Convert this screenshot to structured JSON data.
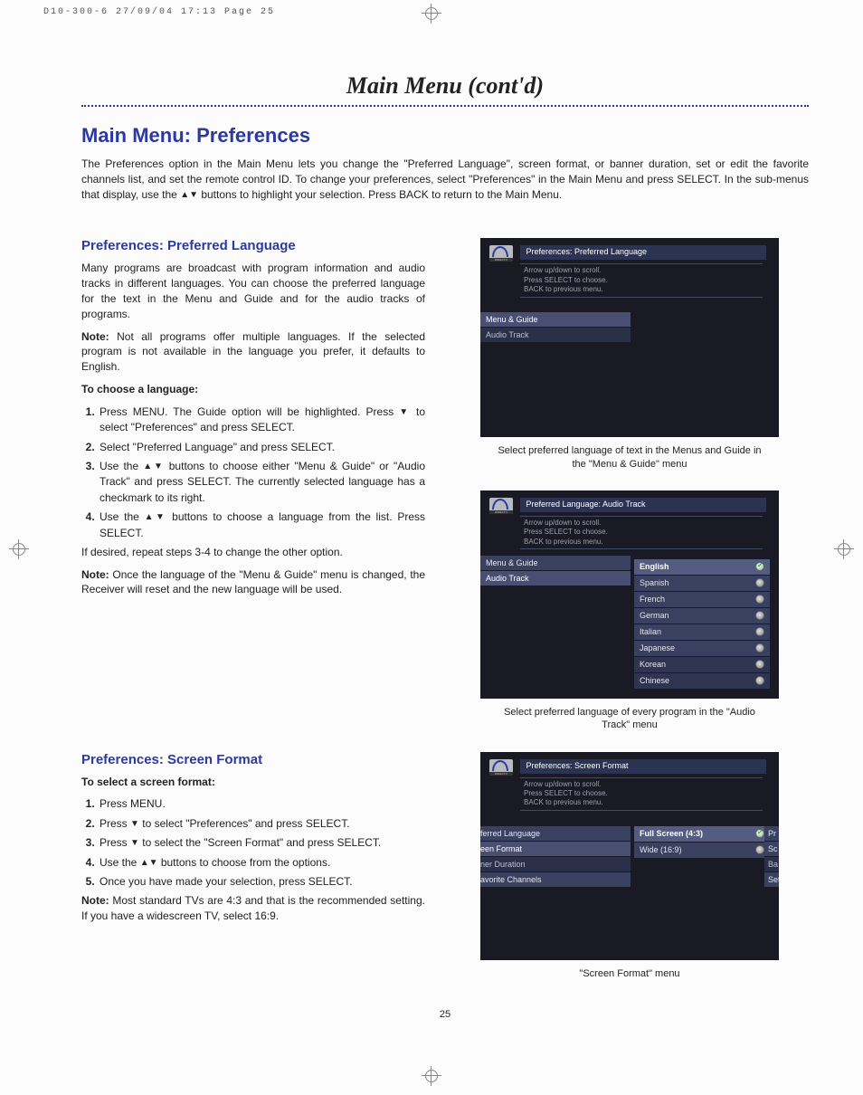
{
  "header_strip": "D10-300-6  27/09/04  17:13  Page 25",
  "chapter_title": "Main Menu (cont'd)",
  "h1": "Main Menu: Preferences",
  "intro_a": "The Preferences option in the Main Menu lets you change the \"Preferred Language\", screen format, or banner duration, set or edit the favorite channels list, and set the remote control ID. To change your preferences, select \"Preferences\" in the Main Menu and press SELECT. In the sub-menus that display, use the ",
  "intro_b": " buttons to highlight your selection. Press BACK to return to the Main Menu.",
  "pl": {
    "h2": "Preferences: Preferred Language",
    "p1": "Many programs are broadcast with program information and audio tracks in different languages. You can choose the preferred language for the text in the Menu and Guide and for the audio tracks of programs.",
    "note_b": "Note:",
    "note_t": " Not all programs offer multiple languages. If the selected program is not available in the language you prefer, it defaults to English.",
    "choose_h": "To choose a language:",
    "s1a": "Press MENU. The Guide option will be highlighted. Press ",
    "s1b": " to select \"Preferences\" and press SELECT.",
    "s2": "Select \"Preferred Language\" and press SELECT.",
    "s3a": "Use the ",
    "s3b": " buttons to choose either \"Menu & Guide\" or \"Audio Track\" and press SELECT. The currently selected language has a checkmark to its right.",
    "s4a": "Use the ",
    "s4b": " buttons to choose a language from the list. Press SELECT.",
    "after": "If desired, repeat steps 3-4 to change the other option.",
    "note2b": "Note:",
    "note2t": " Once the language of the \"Menu & Guide\" menu is changed, the Receiver will reset and the new language will be used."
  },
  "fig1": {
    "title": "Preferences: Preferred Language",
    "hint1": "Arrow up/down to scroll.",
    "hint2": "Press SELECT to choose.",
    "hint3": "BACK to previous menu.",
    "sb1": "Menu & Guide",
    "sb2": "Audio Track",
    "caption": "Select preferred language of text in the Menus and Guide in the \"Menu & Guide\" menu"
  },
  "fig2": {
    "title": "Preferred Language: Audio Track",
    "hint1": "Arrow up/down to scroll.",
    "hint2": "Press SELECT to choose.",
    "hint3": "BACK to previous menu.",
    "sb1": "Menu & Guide",
    "sb2": "Audio Track",
    "langs": [
      "English",
      "Spanish",
      "French",
      "German",
      "Italian",
      "Japanese",
      "Korean",
      "Chinese"
    ],
    "caption": "Select preferred language of every program in the \"Audio Track\" menu"
  },
  "sf": {
    "h2": "Preferences: Screen Format",
    "choose_h": "To select a screen format:",
    "s1": "Press MENU.",
    "s2a": "Press ",
    "s2b": " to select \"Preferences\" and press SELECT.",
    "s3a": "Press ",
    "s3b": " to select the \"Screen Format\" and press SELECT.",
    "s4a": "Use the ",
    "s4b": " buttons to choose from the options.",
    "s5": "Once you have made your selection, press SELECT.",
    "note_b": "Note:",
    "note_t": " Most standard TVs are 4:3 and that is the recommended setting. If you have a widescreen TV, select 16:9."
  },
  "fig3": {
    "title": "Preferences: Screen Format",
    "hint1": "Arrow up/down to scroll.",
    "hint2": "Press SELECT to choose.",
    "hint3": "BACK to previous menu.",
    "sb1": "ferred Language",
    "sb2": "een Format",
    "sb3": "ner Duration",
    "sb4": "avorite Channels",
    "r1": "Pr",
    "r2": "Sc",
    "r3": "Ba",
    "r4": "Set",
    "opt1": "Full Screen (4:3)",
    "opt2": "Wide (16:9)",
    "caption": "\"Screen Format\" menu"
  },
  "pagenum": "25"
}
